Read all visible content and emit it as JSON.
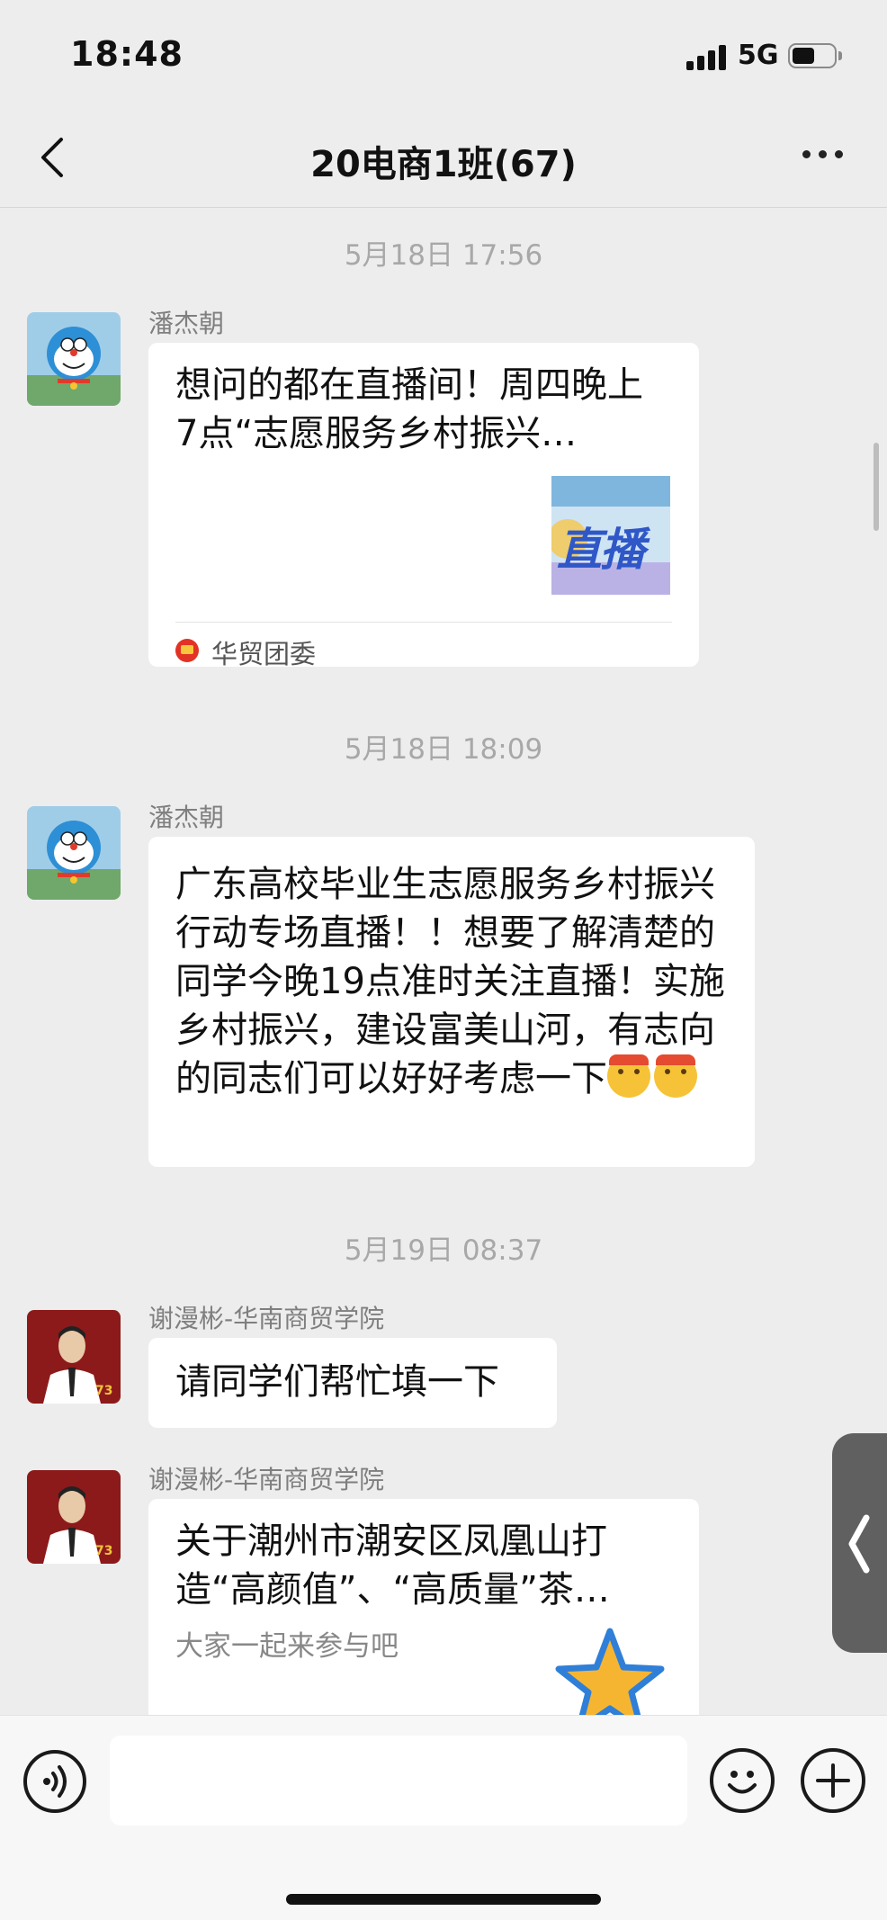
{
  "status_bar": {
    "time": "18:48",
    "network": "5G",
    "battery_level_fraction": 0.55
  },
  "header": {
    "title": "20电商1班(67)",
    "back_icon": "chevron-left-icon",
    "more_icon": "ellipsis-icon"
  },
  "messages": [
    {
      "timestamp": "5月18日 17:56",
      "sender": "潘杰朝",
      "type": "link_card",
      "title": "想问的都在直播间！周四晚上7点“志愿服务乡村振兴…",
      "thumbnail_text": "直播",
      "source": "华贸团委"
    },
    {
      "timestamp": "5月18日 18:09",
      "sender": "潘杰朝",
      "type": "text",
      "text": "广东高校毕业生志愿服务乡村振兴行动专场直播！！想要了解清楚的同学今晚19点准时关注直播！实施乡村振兴，建设富美山河，有志向的同志们可以好好考虑一下",
      "emoji_count": 2
    },
    {
      "timestamp": "5月19日 08:37",
      "sender": "谢漫彬-华南商贸学院",
      "type": "text",
      "text": "请同学们帮忙填一下"
    },
    {
      "sender": "谢漫彬-华南商贸学院",
      "type": "link_card",
      "title": "关于潮州市潮安区凤凰山打造“高颜值”、“高质量”茶…",
      "description": "大家一起来参与吧"
    }
  ],
  "input_bar": {
    "placeholder": ""
  },
  "colors": {
    "background": "#ededed",
    "bubble": "#ffffff",
    "timestamp": "#a8a8a8",
    "sender": "#7f7f7f"
  }
}
